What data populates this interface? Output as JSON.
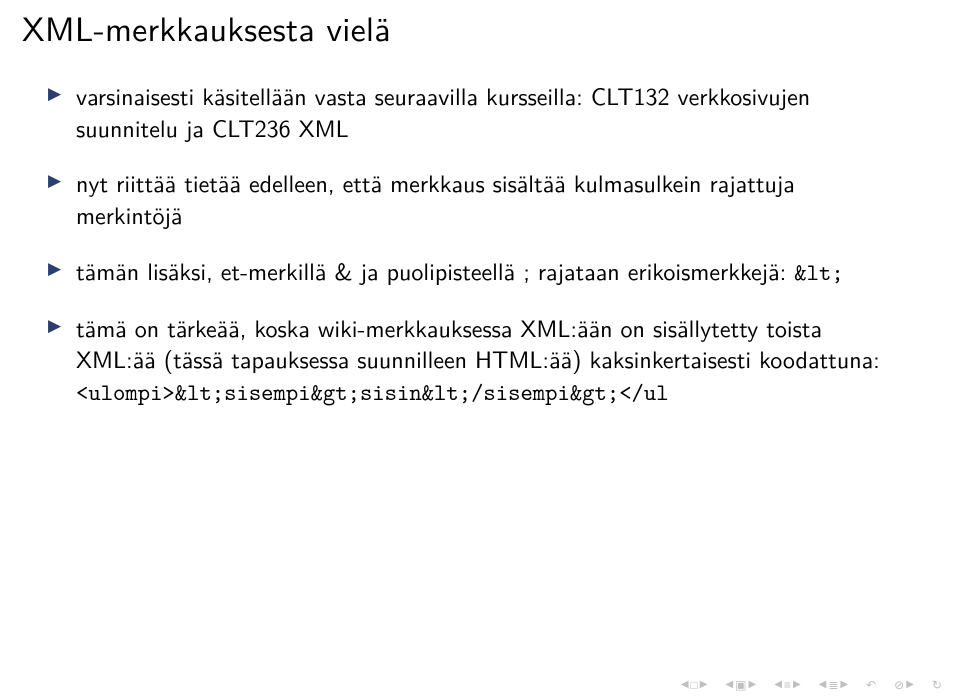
{
  "title": "XML-merkkauksesta vielä",
  "bullets": [
    {
      "pre": "varsinaisesti käsitellään vasta seuraavilla kursseilla: CLT132 verkkosivujen suunnitelu ja CLT236 XML"
    },
    {
      "pre": "nyt riittää tietää edelleen, että merkkaus sisältää kulmasulkein rajattuja merkintöjä"
    },
    {
      "pre": "tämän lisäksi, et-merkillä & ja puolipisteellä ; rajataan erikoismerkkejä: ",
      "code1": "&lt;"
    },
    {
      "pre": "tämä on tärkeää, koska wiki-merkkauksessa XML:ään on sisällytetty toista XML:ää (tässä tapauksessa suunnilleen HTML:ää) kaksinkertaisesti koodattuna: ",
      "code1": "<ulompi>&lt;sisempi&gt;sisin&lt;/sisempi&gt;</ul"
    }
  ]
}
